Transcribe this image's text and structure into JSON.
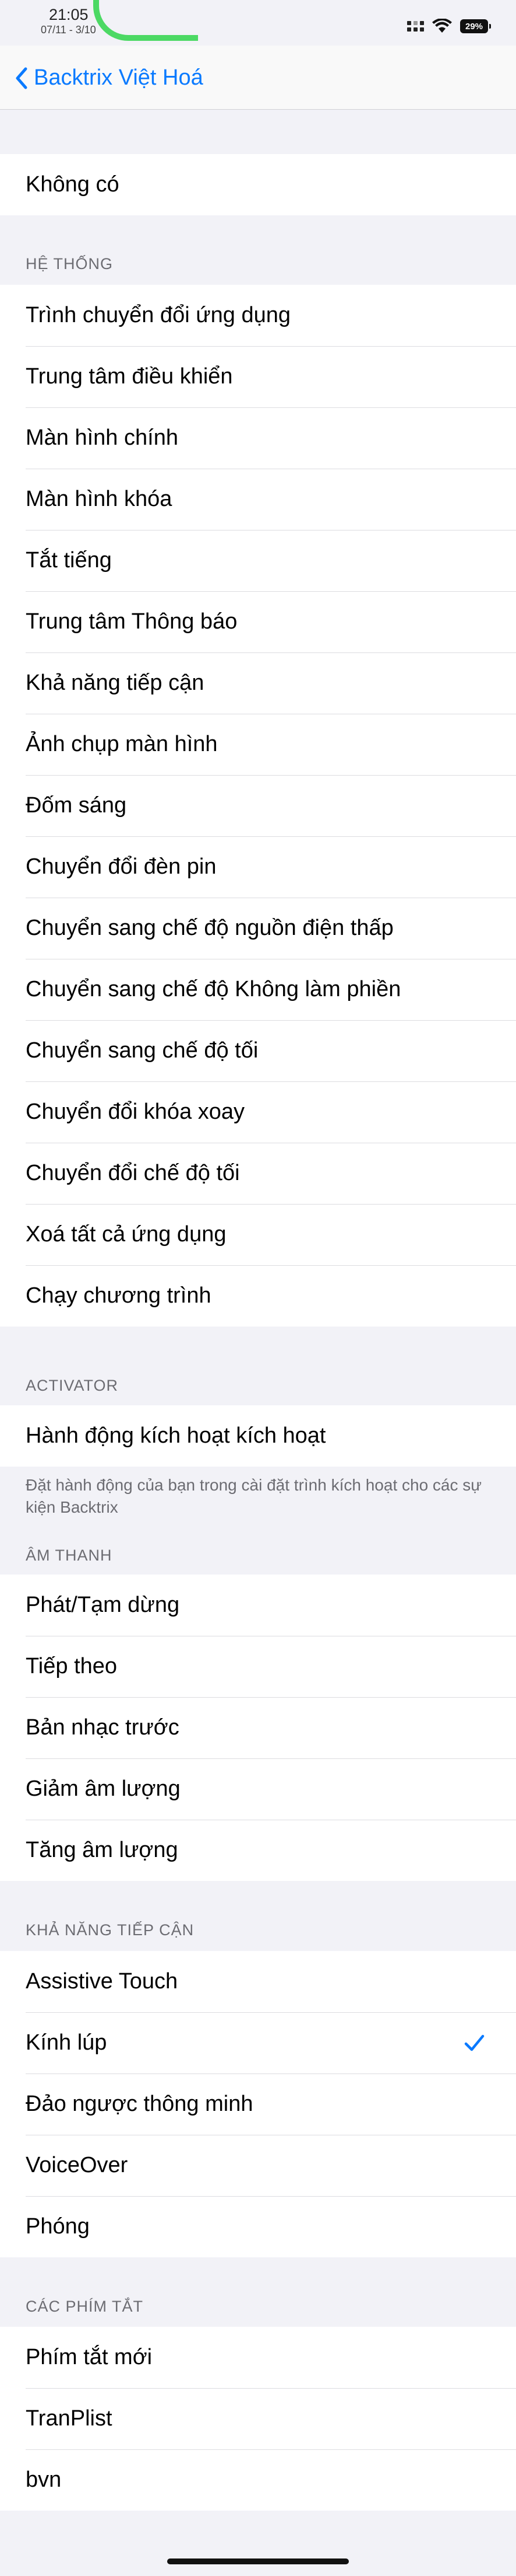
{
  "status": {
    "time": "21:05",
    "date": "07/11 - 3/10",
    "battery": "29%"
  },
  "nav": {
    "back_label": "Backtrix Việt Hoá"
  },
  "none_section": {
    "item": "Không có"
  },
  "system": {
    "header": "HỆ THỐNG",
    "items": [
      "Trình chuyển đổi ứng dụng",
      "Trung tâm điều khiển",
      "Màn hình chính",
      "Màn hình khóa",
      "Tắt tiếng",
      "Trung tâm Thông báo",
      "Khả năng tiếp cận",
      "Ảnh chụp màn hình",
      "Đốm sáng",
      "Chuyển đổi đèn pin",
      "Chuyển sang chế độ nguồn điện thấp",
      "Chuyển sang chế độ Không làm phiền",
      "Chuyển sang chế độ tối",
      "Chuyển đổi khóa xoay",
      "Chuyển đổi chế độ tối",
      "Xoá tất cả ứng dụng",
      "Chạy chương trình"
    ]
  },
  "activator": {
    "header": "ACTIVATOR",
    "items": [
      "Hành động kích hoạt kích hoạt"
    ],
    "footer": "Đặt hành động của bạn trong cài đặt trình kích hoạt cho các sự kiện Backtrix"
  },
  "sound": {
    "header": "ÂM THANH",
    "items": [
      "Phát/Tạm dừng",
      "Tiếp theo",
      "Bản nhạc trước",
      "Giảm âm lượng",
      "Tăng âm lượng"
    ]
  },
  "accessibility": {
    "header": "KHẢ NĂNG TIẾP CẬN",
    "items": [
      "Assistive Touch",
      "Kính lúp",
      "Đảo ngược thông minh",
      "VoiceOver",
      "Phóng"
    ],
    "selected": "Kính lúp"
  },
  "shortcuts": {
    "header": "CÁC PHÍM TẮT",
    "items": [
      "Phím tắt mới",
      "TranPlist",
      "bvn"
    ]
  },
  "colors": {
    "accent": "#0a7aff",
    "background": "#f2f2f7",
    "header_text": "#6c6c72"
  },
  "icons": {
    "back": "chevron-left-icon",
    "check": "checkmark-icon",
    "wifi": "wifi-icon",
    "signal": "signal-icon"
  }
}
